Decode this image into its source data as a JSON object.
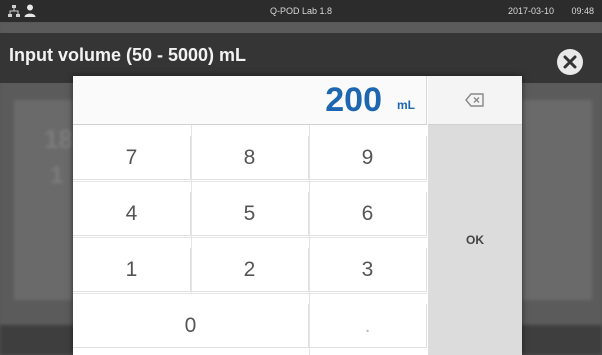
{
  "status_bar": {
    "network_icon": "network-icon",
    "user_icon": "user-icon",
    "title": "Q-POD Lab 1.8",
    "date": "2017-03-10",
    "time": "09:48"
  },
  "background": {
    "ghost_text_1": "18.",
    "ghost_text_2": "1"
  },
  "dialog": {
    "title": "Input volume (50 - 5000) mL",
    "close_icon": "close-icon"
  },
  "keypad": {
    "display_value": "200",
    "display_unit": "mL",
    "backspace_icon": "backspace-icon",
    "keys": [
      "7",
      "8",
      "9",
      "4",
      "5",
      "6",
      "1",
      "2",
      "3",
      "0",
      "."
    ],
    "ok_label": "OK"
  },
  "colors": {
    "accent": "#1e67b0",
    "header_bg": "#343434",
    "keypad_bg": "#ffffff",
    "ok_bg": "#dcdcdc"
  }
}
